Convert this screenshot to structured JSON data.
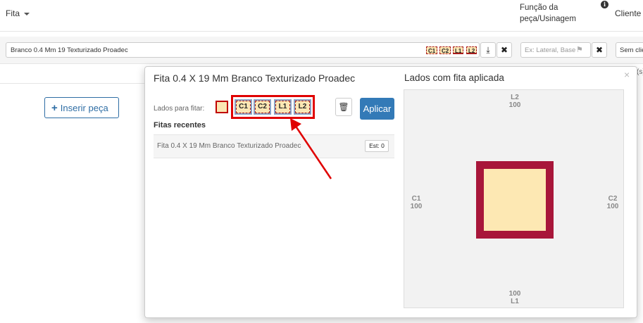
{
  "header": {
    "fita_label": "Fita",
    "funcao_label": "Função da peça/Usinagem",
    "info_icon_text": "i",
    "cliente_label": "Cliente"
  },
  "filter": {
    "fita_value": "Branco 0.4 Mm 19 Texturizado Proadec",
    "side_chips": [
      "C1",
      "C2",
      "L1",
      "L2"
    ],
    "download_icon_text": "⤓",
    "clear_icon_text": "✖",
    "funcao_placeholder": "Ex: Lateral, Base",
    "funcao_clear_text": "✖",
    "flag_icon_text": "⚑",
    "cliente_value": "Sem cliente"
  },
  "page": {
    "inserir_label": "Inserir peça",
    "inserir_plus": "+",
    "bg_fragment": "(s)"
  },
  "popover": {
    "title": "Fita 0.4 X 19 Mm Branco Texturizado Proadec",
    "close_text": "×",
    "lados_label": "Lados para fitar:",
    "chips": [
      "C1",
      "C2",
      "L1",
      "L2"
    ],
    "trash_text": "🗑",
    "apply_label": "Aplicar",
    "recent_title": "Fitas recentes",
    "recent": [
      {
        "name": "Fita 0.4 X 19 Mm Branco Texturizado Proadec",
        "badge": "Est: 0"
      }
    ],
    "diagram_title": "Lados com fita aplicada",
    "sides": {
      "L2": {
        "name": "L2",
        "value": "100"
      },
      "C1": {
        "name": "C1",
        "value": "100"
      },
      "C2": {
        "name": "C2",
        "value": "100"
      },
      "L1": {
        "name": "L1",
        "value": "100"
      }
    }
  },
  "colors": {
    "accent": "#337ab7",
    "edge_band": "#a8163a",
    "panel_fill": "#fde8b3",
    "highlight": "#e00000"
  }
}
